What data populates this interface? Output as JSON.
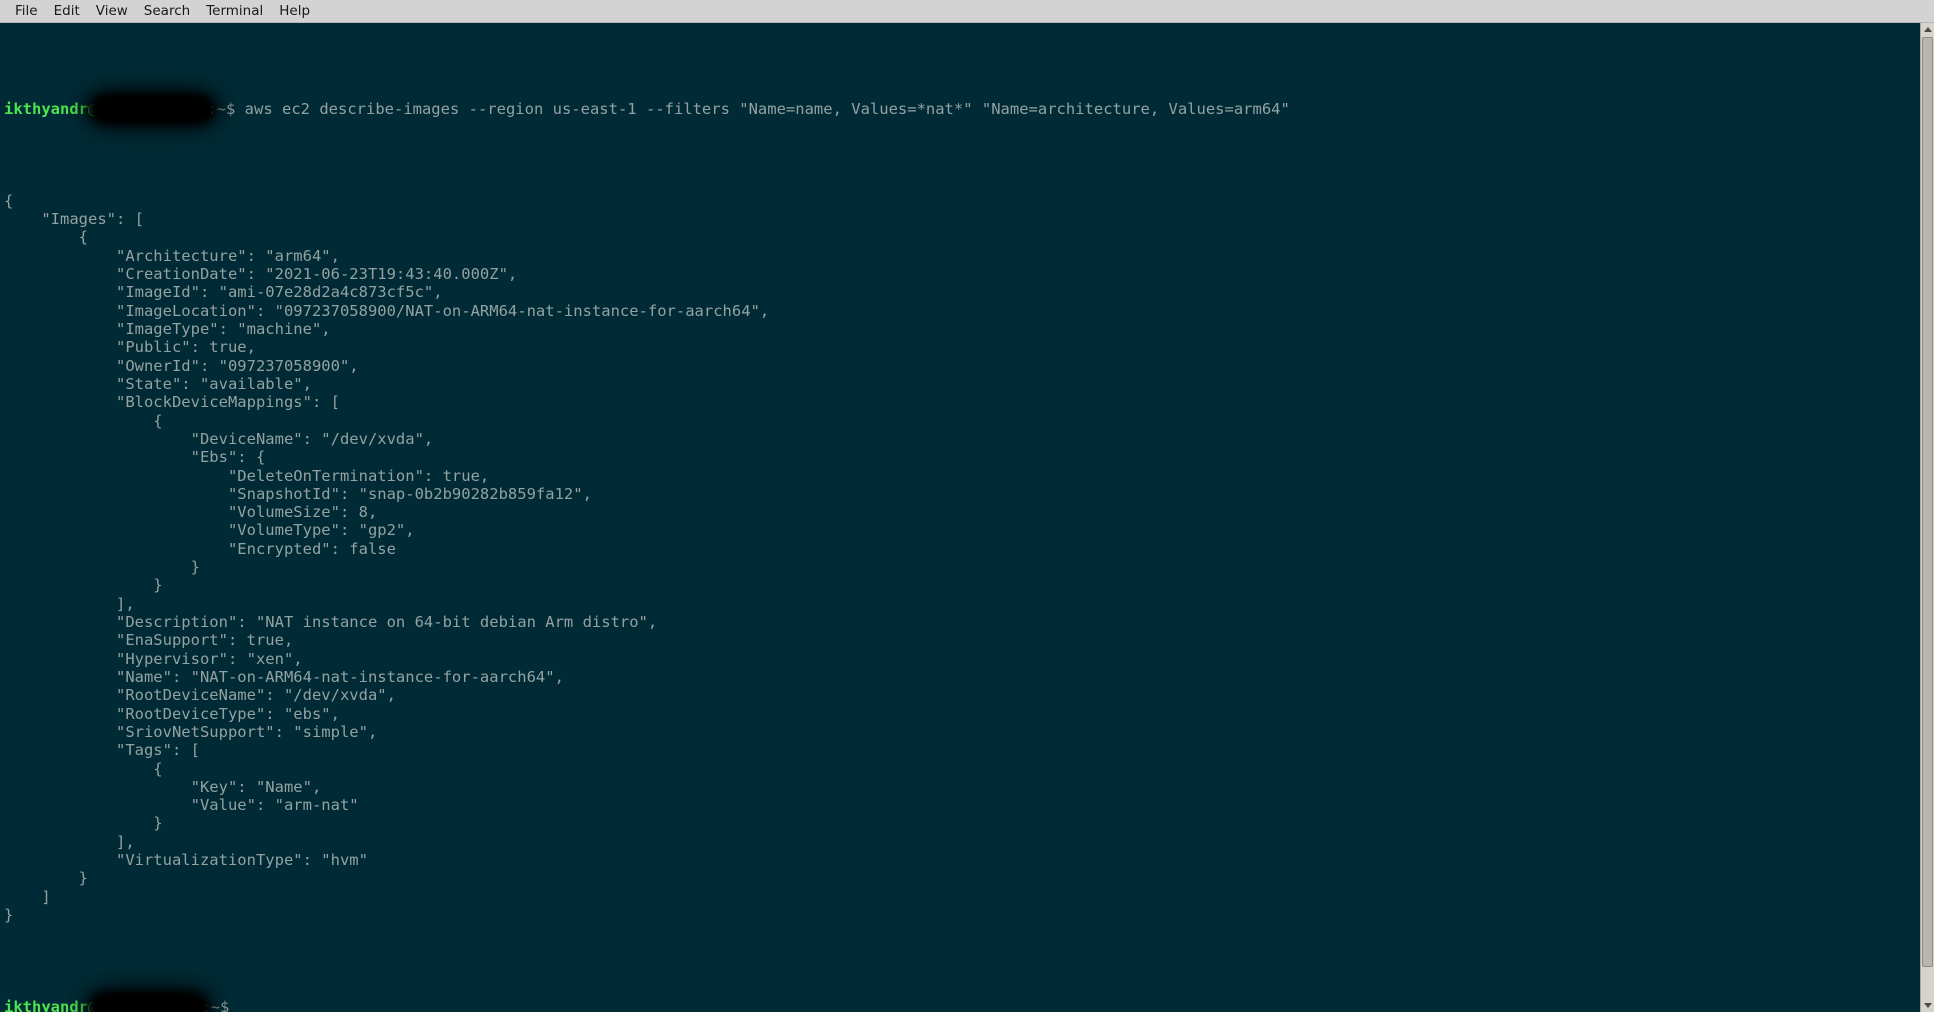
{
  "window": {
    "title": "Terminal",
    "background_color": "#002b36",
    "foreground_color": "#93a1a1",
    "prompt_color": "#4ee44e"
  },
  "menubar": {
    "items": [
      {
        "label": "File"
      },
      {
        "label": "Edit"
      },
      {
        "label": "View"
      },
      {
        "label": "Search"
      },
      {
        "label": "Terminal"
      },
      {
        "label": "Help"
      }
    ]
  },
  "prompt": {
    "user": "ikthyandr",
    "at": "@",
    "host_redacted": true,
    "path": ":~$"
  },
  "command": {
    "text": " aws ec2 describe-images --region us-east-1 --filters \"Name=name, Values=*nat*\" \"Name=architecture, Values=arm64\""
  },
  "output": {
    "lines": [
      "{",
      "    \"Images\": [",
      "        {",
      "            \"Architecture\": \"arm64\",",
      "            \"CreationDate\": \"2021-06-23T19:43:40.000Z\",",
      "            \"ImageId\": \"ami-07e28d2a4c873cf5c\",",
      "            \"ImageLocation\": \"097237058900/NAT-on-ARM64-nat-instance-for-aarch64\",",
      "            \"ImageType\": \"machine\",",
      "            \"Public\": true,",
      "            \"OwnerId\": \"097237058900\",",
      "            \"State\": \"available\",",
      "            \"BlockDeviceMappings\": [",
      "                {",
      "                    \"DeviceName\": \"/dev/xvda\",",
      "                    \"Ebs\": {",
      "                        \"DeleteOnTermination\": true,",
      "                        \"SnapshotId\": \"snap-0b2b90282b859fa12\",",
      "                        \"VolumeSize\": 8,",
      "                        \"VolumeType\": \"gp2\",",
      "                        \"Encrypted\": false",
      "                    }",
      "                }",
      "            ],",
      "            \"Description\": \"NAT instance on 64-bit debian Arm distro\",",
      "            \"EnaSupport\": true,",
      "            \"Hypervisor\": \"xen\",",
      "            \"Name\": \"NAT-on-ARM64-nat-instance-for-aarch64\",",
      "            \"RootDeviceName\": \"/dev/xvda\",",
      "            \"RootDeviceType\": \"ebs\",",
      "            \"SriovNetSupport\": \"simple\",",
      "            \"Tags\": [",
      "                {",
      "                    \"Key\": \"Name\",",
      "                    \"Value\": \"arm-nat\"",
      "                }",
      "            ],",
      "            \"VirtualizationType\": \"hvm\"",
      "        }",
      "    ]",
      "}"
    ]
  },
  "final_prompt": {
    "user": "ikthyandr",
    "at": "@",
    "path": ":~$"
  },
  "scrollbar": {
    "up_arrow": "scroll-up",
    "down_arrow": "scroll-down"
  }
}
